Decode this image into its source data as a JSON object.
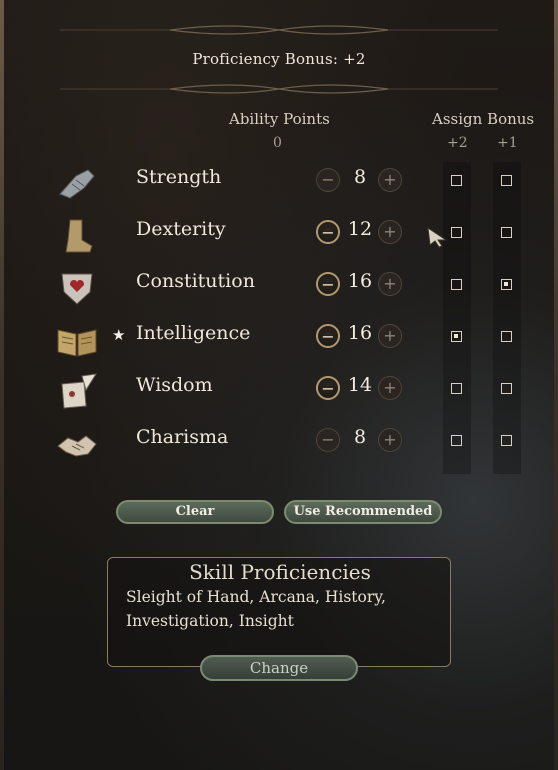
{
  "proficiency_bonus": "Proficiency Bonus: +2",
  "headers": {
    "ability_points": "Ability Points",
    "ability_points_remaining": "0",
    "assign_bonus": "Assign Bonus",
    "bonus_plus2": "+2",
    "bonus_plus1": "+1"
  },
  "abilities": [
    {
      "name": "Strength",
      "value": "8",
      "icon": "gauntlet-icon",
      "starred": false,
      "minus_active": false,
      "plus2": false,
      "plus1": false
    },
    {
      "name": "Dexterity",
      "value": "12",
      "icon": "boot-icon",
      "starred": false,
      "minus_active": true,
      "plus2": false,
      "plus1": false
    },
    {
      "name": "Constitution",
      "value": "16",
      "icon": "shield-heart-icon",
      "starred": false,
      "minus_active": true,
      "plus2": false,
      "plus1": true
    },
    {
      "name": "Intelligence",
      "value": "16",
      "icon": "open-book-icon",
      "starred": true,
      "minus_active": true,
      "plus2": true,
      "plus1": false
    },
    {
      "name": "Wisdom",
      "value": "14",
      "icon": "scroll-quill-icon",
      "starred": false,
      "minus_active": true,
      "plus2": false,
      "plus1": false
    },
    {
      "name": "Charisma",
      "value": "8",
      "icon": "handshake-icon",
      "starred": false,
      "minus_active": false,
      "plus2": false,
      "plus1": false
    }
  ],
  "star_glyph": "★",
  "minus_glyph": "−",
  "plus_glyph": "+",
  "buttons": {
    "clear": "Clear",
    "use_recommended": "Use Recommended",
    "change": "Change"
  },
  "skills": {
    "title": "Skill Proficiencies",
    "list": "Sleight of Hand, Arcana, History, Investigation, Insight"
  }
}
